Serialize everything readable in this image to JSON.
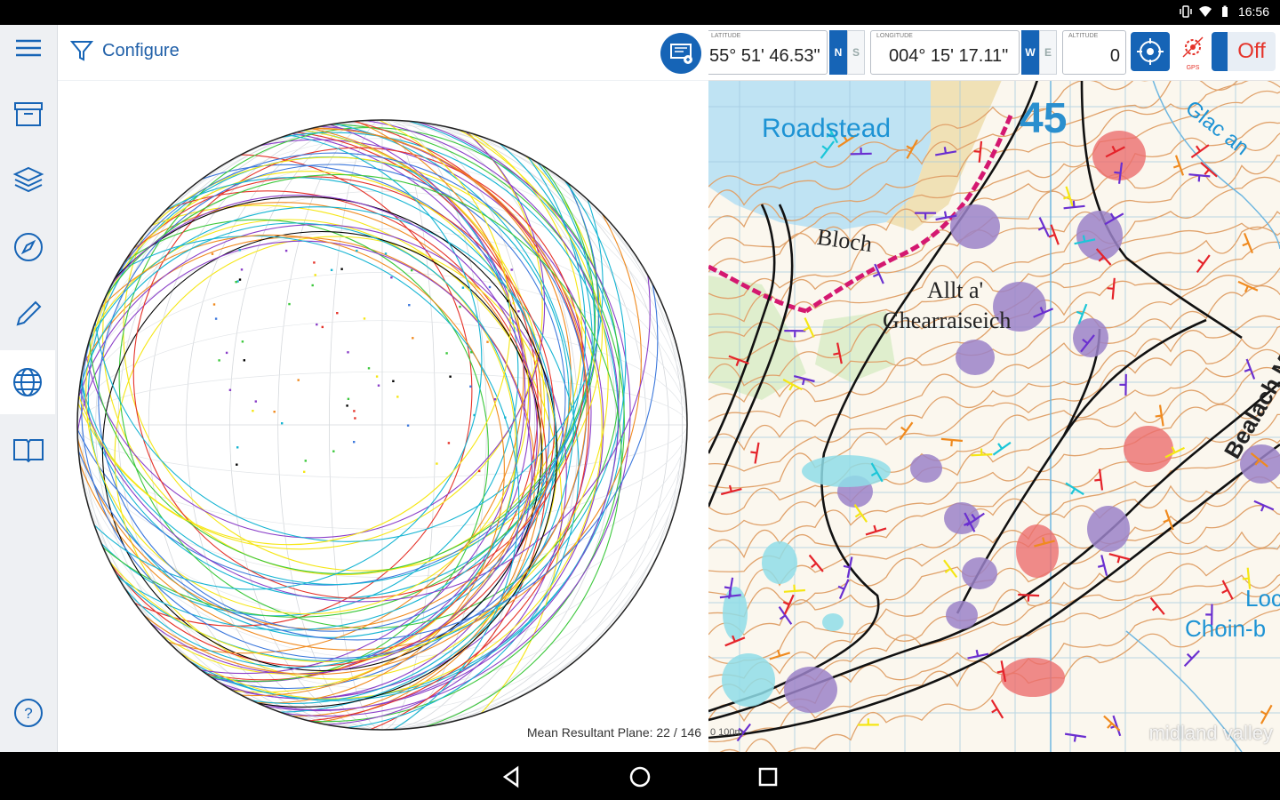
{
  "status_bar": {
    "time": "16:56"
  },
  "sidebar": {
    "items": [
      {
        "name": "menu"
      },
      {
        "name": "archive"
      },
      {
        "name": "layers"
      },
      {
        "name": "compass"
      },
      {
        "name": "pencil"
      },
      {
        "name": "globe",
        "active": true
      },
      {
        "name": "book"
      }
    ]
  },
  "stereo": {
    "configure_label": "Configure",
    "mean_resultant": "Mean Resultant Plane: 22 / 146",
    "colors": [
      "#e5332a",
      "#f5e614",
      "#3cc83c",
      "#14b4d2",
      "#8a3ec8",
      "#f08a1e",
      "#000000",
      "#3c78dc"
    ]
  },
  "gps": {
    "latitude_label": "LATITUDE",
    "latitude": "55° 51' 46.53\"",
    "lat_hemi": [
      "N",
      "S"
    ],
    "longitude_label": "LONGITUDE",
    "longitude": "004° 15' 17.11\"",
    "lon_hemi": [
      "W",
      "E"
    ],
    "altitude_label": "ALTITUDE",
    "altitude": "0",
    "gps_label": "GPS",
    "toggle": "Off"
  },
  "map": {
    "labels": {
      "roadstead": "Roadstead",
      "grid_num": "45",
      "glac": "Glac an",
      "bloch": "Bloch",
      "allt": "Allt a'",
      "ghearraiseich": "Ghearraiseich",
      "bealach": "Bealach M",
      "loch": "Loch",
      "choin": "Choin-b",
      "scale": "0   100m"
    },
    "watermark": "midland valley"
  }
}
